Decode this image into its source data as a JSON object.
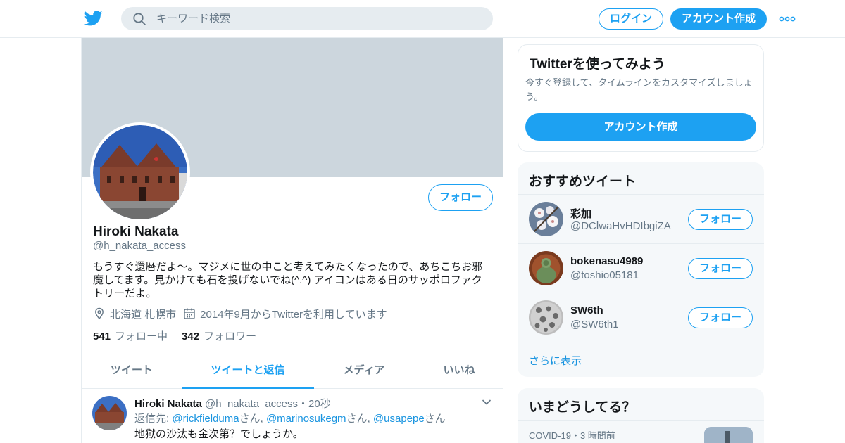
{
  "colors": {
    "accent": "#1da1f2",
    "banner": "#ccd6dd",
    "muted": "#657786",
    "text": "#14171a"
  },
  "header": {
    "logo_icon": "twitter-bird-icon",
    "search_placeholder": "キーワード検索",
    "login_label": "ログイン",
    "signup_label": "アカウント作成",
    "more_icon": "more-dots-icon"
  },
  "profile": {
    "name": "Hiroki Nakata",
    "handle": "@h_nakata_access",
    "follow_label": "フォロー",
    "bio_line1": "もうすぐ還暦だよ〜。マジメに世の中こと考えてみたくなったので、あちこちお邪",
    "bio_line2": "魔してます。見かけても石を投げないでね(^.^) アイコンはある日のサッポロファク",
    "bio_line3": "トリーだよ。",
    "location": "北海道 札幌市",
    "joined": "2014年9月からTwitterを利用しています",
    "following_count": "541",
    "following_label": "フォロー中",
    "followers_count": "342",
    "followers_label": "フォロワー"
  },
  "tabs": [
    {
      "label": "ツイート"
    },
    {
      "label": "ツイートと返信"
    },
    {
      "label": "メディア"
    },
    {
      "label": "いいね"
    }
  ],
  "tweet": {
    "name": "Hiroki Nakata",
    "handle": "@h_nakata_access",
    "dot": "・",
    "time": "20秒",
    "reply_prefix": "返信先: ",
    "mention1": "@rickfielduma",
    "san1": "さん, ",
    "mention2": "@marinosukegm",
    "san2": "さん, ",
    "mention3": "@usapepe",
    "san3": "さん",
    "text": "地獄の沙汰も金次第？でしょうか。"
  },
  "signup_card": {
    "title": "Twitterを使ってみよう",
    "description": "今すぐ登録して、タイムラインをカスタマイズしましょう。",
    "cta": "アカウント作成"
  },
  "who_to_follow": {
    "title": "おすすめツイート",
    "follow_label": "フォロー",
    "users": [
      {
        "name": "彩加",
        "handle": "@DClwaHvHDIbgiZA"
      },
      {
        "name": "bokenasu4989",
        "handle": "@toshio05181"
      },
      {
        "name": "SW6th",
        "handle": "@SW6th1"
      }
    ],
    "show_more": "さらに表示"
  },
  "trends": {
    "title": "いまどうしてる？",
    "item_meta": "COVID-19・3 時間前"
  }
}
